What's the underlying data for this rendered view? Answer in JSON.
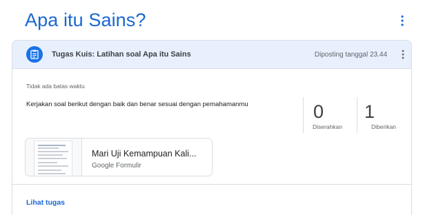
{
  "topic": {
    "title": "Apa itu Sains?",
    "more_icon": "more-vert-icon"
  },
  "assignment": {
    "icon": "assignment-icon",
    "title": "Tugas Kuis: Latihan soal Apa itu Sains",
    "posted": "Diposting tanggal 23.44",
    "more_icon": "more-vert-icon",
    "due": "Tidak ada batas waktu",
    "instructions": "Kerjakan soal berikut dengan baik dan benar sesuai dengan pemahamanmu",
    "stats": {
      "turned_in": {
        "count": "0",
        "label": "Diserahkan"
      },
      "assigned": {
        "count": "1",
        "label": "Diberikan"
      }
    },
    "attachment": {
      "title": "Mari Uji Kemampuan Kali...",
      "type": "Google Formulir"
    },
    "view_link": "Lihat tugas"
  },
  "colors": {
    "accent": "#1967d2",
    "header_bg": "#e8f0fe",
    "icon_bg": "#1a73e8",
    "border": "#dadce0"
  }
}
